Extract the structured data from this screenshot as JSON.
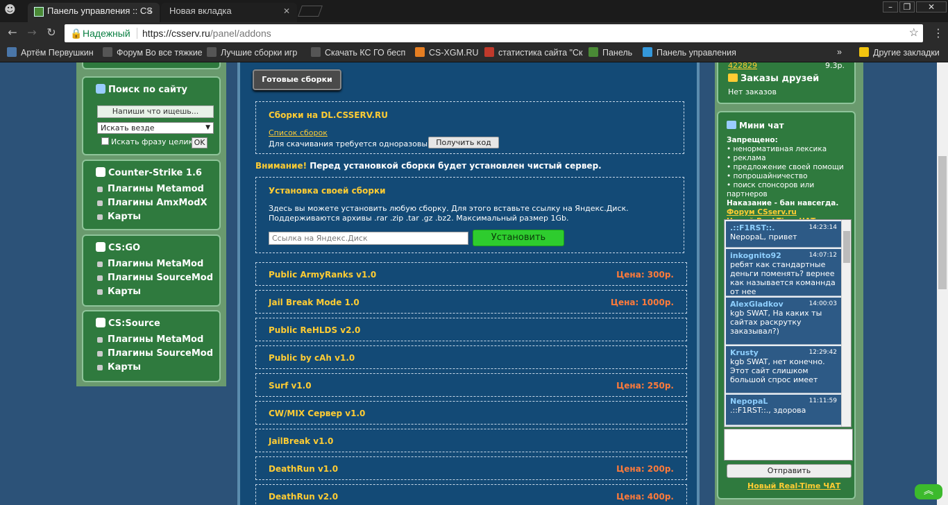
{
  "browser": {
    "tabs": [
      {
        "label": "Панель управления :: CS"
      },
      {
        "label": "Новая вкладка"
      }
    ],
    "security_label": "Надежный",
    "url_host": "https://csserv.ru",
    "url_path": "/panel/addons",
    "bookmarks": [
      "Артём Первушкин",
      "Форум Во все тяжкие",
      "Лучшие сборки игр",
      "Скачать КС ГО бесп",
      "CS-XGM.RU",
      "статистика сайта \"Ск",
      "Панель",
      "Панель управления"
    ],
    "other_bookmarks": "Другие закладки"
  },
  "left": {
    "search": {
      "title": "Поиск по сайту",
      "placeholder": "Напиши что ищешь...",
      "scope": "Искать везде",
      "phrase_label": "Искать фразу целиком",
      "ok": "OK"
    },
    "cs16": {
      "title": "Counter-Strike 1.6",
      "items": [
        "Плагины Metamod",
        "Плагины AmxModX",
        "Карты"
      ]
    },
    "csgo": {
      "title": "CS:GO",
      "items": [
        "Плагины MetaMod",
        "Плагины SourceMod",
        "Карты"
      ]
    },
    "css": {
      "title": "CS:Source",
      "items": [
        "Плагины MetaMod",
        "Плагины SourceMod",
        "Карты"
      ]
    }
  },
  "center": {
    "ready_button": "Готовые сборки",
    "dl": {
      "title": "Сборки на DL.CSSERV.RU",
      "link": "Список сборок",
      "note": "Для скачивания требуется одноразовый код",
      "button": "Получить код"
    },
    "warning_bold": "Внимание!",
    "warning_text": " Перед установкой сборки будет установлен чистый сервер.",
    "install": {
      "title": "Установка своей сборки",
      "text": "Здесь вы можете установить любую сборку. Для этого вставьте ссылку на Яндекс.Диск. Поддерживаются архивы .rar .zip .tar .gz .bz2. Максимальный размер 1Gb.",
      "placeholder": "Ссылка на Яндекс.Диск",
      "button": "Установить"
    },
    "addons": [
      {
        "name": "Public ArmyRanks v1.0",
        "price": "Цена: 300р."
      },
      {
        "name": "Jail Break Mode 1.0",
        "price": "Цена: 1000р."
      },
      {
        "name": "Public ReHLDS v2.0",
        "price": ""
      },
      {
        "name": "Public by cAh v1.0",
        "price": ""
      },
      {
        "name": "Surf v1.0",
        "price": "Цена: 250р."
      },
      {
        "name": "CW/MIX Сервер v1.0",
        "price": ""
      },
      {
        "name": "JailBreak v1.0",
        "price": ""
      },
      {
        "name": "DeathRun v1.0",
        "price": "Цена: 200р."
      },
      {
        "name": "DeathRun v2.0",
        "price": "Цена: 400р."
      }
    ]
  },
  "right": {
    "ref_number": "422829",
    "ref_value": "9.3р.",
    "friends_title": "Заказы друзей",
    "friends_empty": "Нет заказов",
    "chat_title": "Мини чат",
    "rules": {
      "head": "Запрещено:",
      "items": [
        "• ненормативная лексика",
        "• реклама",
        "• предложение своей помощи",
        "• попрошайничество",
        "• поиск спонсоров или партнеров"
      ],
      "penalty": "Наказание - бан навсегда.",
      "forum": "Форум CSserv.ru",
      "realtime": "Новый Real-Time ЧАТ"
    },
    "messages": [
      {
        "user": ".::F1RST::.",
        "time": "14:23:14",
        "text": "NepopaL, привет"
      },
      {
        "user": "inkognito92",
        "time": "14:07:12",
        "text": "ребят как стандартные деньги поменять? вернее как называется команнда от нее"
      },
      {
        "user": "AlexGladkov",
        "time": "14:00:03",
        "text": "kgb SWAT, На каких ты сайтах раскрутку заказывал?)"
      },
      {
        "user": "Krusty",
        "time": "12:29:42",
        "text": "kgb SWAT, нет конечно. Этот сайт слишком большой спрос имеет"
      },
      {
        "user": "NepopaL",
        "time": "11:11:59",
        "text": ".::F1RST::., здорова"
      }
    ],
    "send": "Отправить",
    "realtime2": "Новый Real-Time ЧАТ"
  }
}
